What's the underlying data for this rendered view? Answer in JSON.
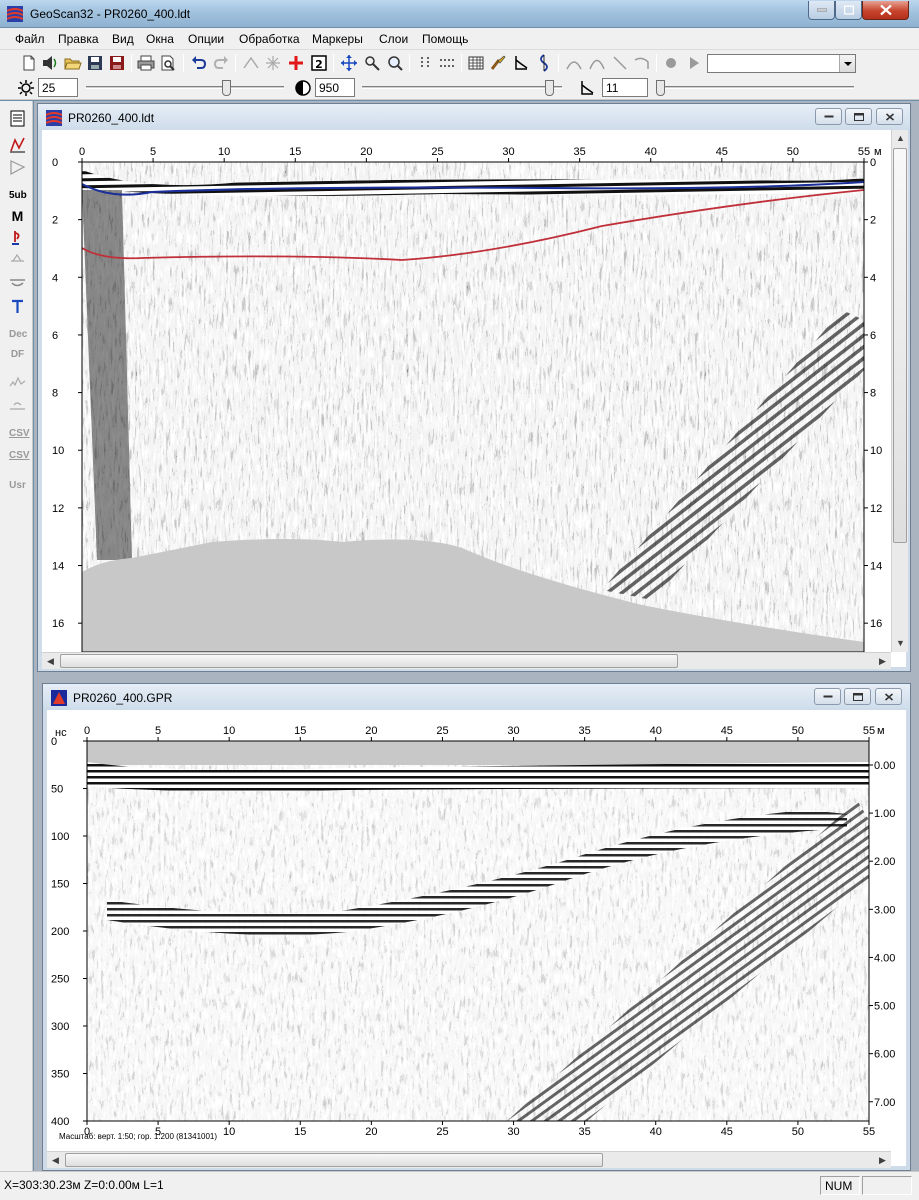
{
  "window": {
    "title": "GeoScan32 - PR0260_400.ldt"
  },
  "menu": [
    "Файл",
    "Правка",
    "Вид",
    "Окна",
    "Опции",
    "Обработка",
    "Маркеры",
    "Слои",
    "Помощь"
  ],
  "toolbar2": {
    "brightness_value": "25",
    "contrast_value": "950",
    "gain_value": "11",
    "brightness_level": 0.72,
    "contrast_level": 0.96,
    "gain_level": 0.0
  },
  "left_toolbar": [
    "5ub",
    "M",
    "Dec",
    "DF",
    "CSV",
    "CSV",
    "Usr"
  ],
  "window1": {
    "title": "PR0260_400.ldt",
    "x_ticks": [
      "0",
      "5",
      "10",
      "15",
      "20",
      "25",
      "30",
      "35",
      "40",
      "45",
      "50",
      "55"
    ],
    "y_ticks": [
      "0",
      "2",
      "4",
      "6",
      "8",
      "10",
      "12",
      "14",
      "16"
    ],
    "x_unit": "м"
  },
  "window2": {
    "title": "PR0260_400.GPR",
    "y_unit": "нс",
    "x_ticks": [
      "0",
      "5",
      "10",
      "15",
      "20",
      "25",
      "30",
      "35",
      "40",
      "45",
      "50",
      "55"
    ],
    "y_ticks": [
      "0",
      "50",
      "100",
      "150",
      "200",
      "250",
      "300",
      "350",
      "400"
    ],
    "right_ticks": [
      "0.00",
      "1.00",
      "2.00",
      "3.00",
      "4.00",
      "5.00",
      "6.00",
      "7.00"
    ],
    "x_unit": "м",
    "scale_caption": "Масштаб: верт. 1:50; гор. 1:200 (81341001)"
  },
  "status": {
    "coords": "X=303:30.23м Z=0:0.00м L=1",
    "num": "NUM"
  },
  "colors": {
    "title_gradient_top": "#bcd7ee",
    "close_red": "#c7442d",
    "ground_fill": "#c8c8c8",
    "marker_blue": "#1b2f9a",
    "marker_red": "#c0303a"
  }
}
